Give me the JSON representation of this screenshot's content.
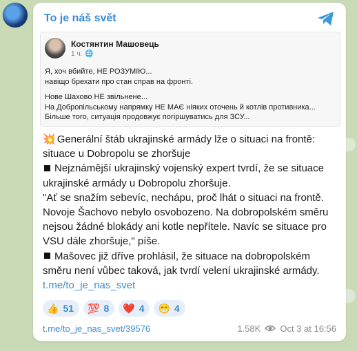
{
  "channel": {
    "title": "To je náš svět"
  },
  "embed": {
    "author": "Костянтин Машовець",
    "time": "1 ч.",
    "lines1": [
      "Я, хоч вбийте, НЕ РОЗУМІЮ...",
      "навіщо брехати про стан справ на фронті."
    ],
    "lines2": [
      "Нове Шахово НЕ звільнене...",
      "На Добропільському напрямку НЕ МАЄ ніяких оточень й котлів противника...",
      "Більше того, ситуація продовжує погіршуватись для ЗСУ..."
    ]
  },
  "message": {
    "headline": "Generální štáb ukrajinské armády lže o situaci na frontě: situace u Dobropolu se zhoršuje",
    "para1": "Nejznámější ukrajinský vojenský expert tvrdí, že se situace ukrajinské armády u Dobropolu zhoršuje.",
    "para2": "\"Ať se snažím sebevíc, nechápu, proč lhát o situaci na frontě. Novoje Šachovo nebylo osvobozeno. Na dobropolském směru nejsou žádné blokády ani kotle nepřítele. Navíc se situace pro VSU dále zhoršuje,\" píše.",
    "para3": "Mašovec již dříve prohlásil, že situace na dobropolském směru není vůbec taková, jak tvrdí velení ukrajinské armády.",
    "link": "t.me/to_je_nas_svet"
  },
  "reactions": [
    {
      "emoji": "👍",
      "count": "51"
    },
    {
      "emoji": "💯",
      "count": "8"
    },
    {
      "emoji": "❤️",
      "count": "4"
    },
    {
      "emoji": "😁",
      "count": "4"
    }
  ],
  "footer": {
    "post_link": "t.me/to_je_nas_svet/39576",
    "views": "1.58K",
    "date": "Oct 3 at 16:56"
  }
}
